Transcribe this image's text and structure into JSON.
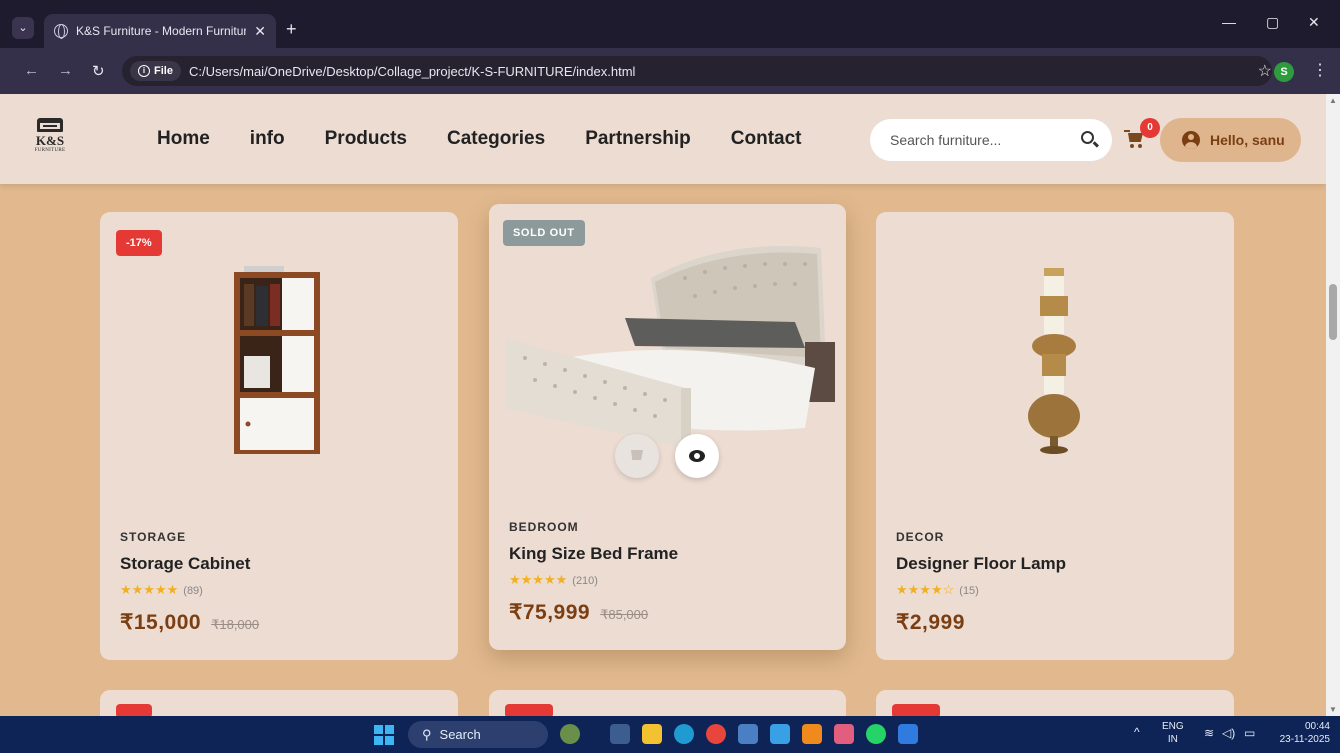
{
  "browser": {
    "tab_title": "K&S Furniture - Modern Furniture",
    "tab_close": "✕",
    "new_tab": "+",
    "file_chip": "File",
    "url": "C:/Users/mai/OneDrive/Desktop/Collage_project/K-S-FURNITURE/index.html",
    "profile_initial": "S",
    "window_controls": [
      "—",
      "▢",
      "✕"
    ]
  },
  "site": {
    "logo_text": "K&S",
    "logo_sub": "FURNITURE",
    "nav": [
      "Home",
      "info",
      "Products",
      "Categories",
      "Partnership",
      "Contact"
    ],
    "search_placeholder": "Search furniture...",
    "cart_count": "0",
    "greeting": "Hello, sanu"
  },
  "products": [
    {
      "badge": "-17%",
      "badge_type": "sale",
      "category": "STORAGE",
      "name": "Storage Cabinet",
      "rating": 4.5,
      "stars": "★★★★★",
      "reviews": "(89)",
      "price": "₹15,000",
      "old_price": "₹18,000"
    },
    {
      "badge": "SOLD OUT",
      "badge_type": "soldout",
      "category": "BEDROOM",
      "name": "King Size Bed Frame",
      "rating": 4.5,
      "stars": "★★★★★",
      "reviews": "(210)",
      "price": "₹75,999",
      "old_price": "₹85,000"
    },
    {
      "badge": "",
      "badge_type": "none",
      "category": "DECOR",
      "name": "Designer Floor Lamp",
      "rating": 4,
      "stars": "★★★★☆",
      "reviews": "(15)",
      "price": "₹2,999",
      "old_price": ""
    }
  ],
  "taskbar": {
    "search_label": "Search",
    "lang_top": "ENG",
    "lang_bottom": "IN",
    "time": "00:44",
    "date": "23-11-2025"
  },
  "colors": {
    "page_bg": "#e2b98e",
    "header_bg": "#eddcd2",
    "card_bg": "#eddcd2",
    "price": "#7a3e12",
    "sale_badge": "#e53935",
    "soldout_badge": "#8c9a9b",
    "star": "#f2b01e"
  }
}
